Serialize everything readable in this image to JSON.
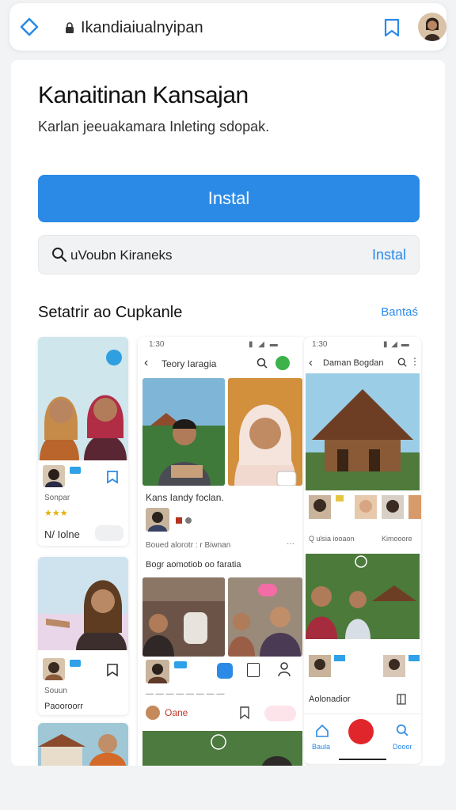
{
  "browser": {
    "url": "Ikandiaiualnyipan",
    "home_icon": "home-icon",
    "lock_icon": "lock-icon",
    "bookmark_icon": "bookmark-icon",
    "accent": "#2b8ae6"
  },
  "page": {
    "title": "Kanaitinan Kansajan",
    "subtitle": "Karlan jeeuakamara Inleting sdopak.",
    "install_button": "Instal",
    "search": {
      "text": "uVoubn Kiraneks",
      "action": "Instal"
    },
    "section": {
      "title": "Setatrir ao Cupkanle",
      "link": "Bantaś"
    }
  },
  "left_column": {
    "card1": {
      "stars": "★★★",
      "label_small": "Sonpar",
      "footer": "N/ Iolne"
    },
    "card2": {
      "label_small": "Souun",
      "footer": "Paooroorr"
    }
  },
  "center_phone": {
    "status_time": "1:30",
    "header": "Teory Iaragia",
    "post_title": "Kans Iandy foclan.",
    "meta_row": "Boued alorotr : r Biwnan",
    "section_line": "Bogr aomotiob oo faratia",
    "bottom_label": "Oane"
  },
  "right_phone": {
    "status_time": "1:30",
    "header": "Daman Bogdan",
    "meta_row": "Q ulsia iooaon",
    "meta_right": "Kimooore",
    "caption": "Aolonadior",
    "nav_home": "Baula",
    "nav_profile": "Dooor"
  }
}
